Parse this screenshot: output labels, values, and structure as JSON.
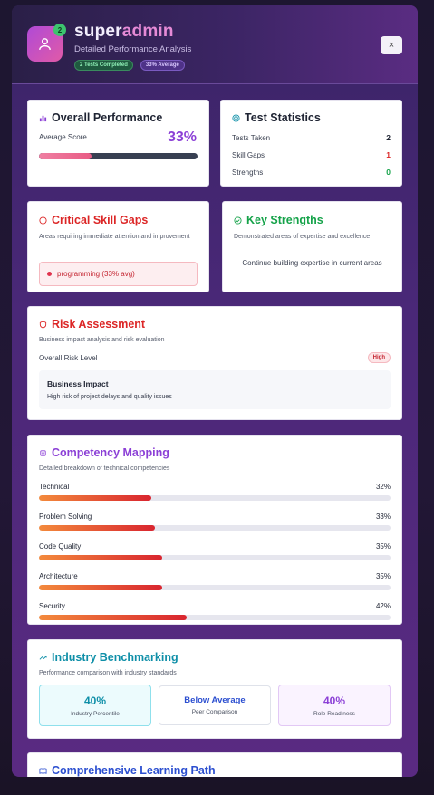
{
  "header": {
    "title_part1": "super",
    "title_part2": "admin",
    "subtitle": "Detailed Performance Analysis",
    "badge_count": "2",
    "chips": [
      "2 Tests Completed",
      "33% Average"
    ],
    "close_label": "×"
  },
  "overall": {
    "title": "Overall Performance",
    "avg_label": "Average Score",
    "avg_value": "33%",
    "avg_fraction": 0.33
  },
  "stats": {
    "title": "Test Statistics",
    "rows": [
      {
        "label": "Tests Taken",
        "value": "2",
        "color": "#1f2433"
      },
      {
        "label": "Skill Gaps",
        "value": "1",
        "color": "#dc2626"
      },
      {
        "label": "Strengths",
        "value": "0",
        "color": "#16a34a"
      }
    ]
  },
  "gaps": {
    "title": "Critical Skill Gaps",
    "subtitle": "Areas requiring immediate attention and improvement",
    "item": "programming (33% avg)"
  },
  "strengths": {
    "title": "Key Strengths",
    "subtitle": "Demonstrated areas of expertise and excellence",
    "empty_text": "Continue building expertise in current areas"
  },
  "risk": {
    "title": "Risk Assessment",
    "subtitle": "Business impact analysis and risk evaluation",
    "level_label": "Overall Risk Level",
    "level_value": "High",
    "impact_title": "Business Impact",
    "impact_text": "High risk of project delays and quality issues"
  },
  "competency": {
    "title": "Competency Mapping",
    "subtitle": "Detailed breakdown of technical competencies",
    "items": [
      {
        "label": "Technical",
        "value": "32%",
        "fraction": 0.32
      },
      {
        "label": "Problem Solving",
        "value": "33%",
        "fraction": 0.33
      },
      {
        "label": "Code Quality",
        "value": "35%",
        "fraction": 0.35
      },
      {
        "label": "Architecture",
        "value": "35%",
        "fraction": 0.35
      },
      {
        "label": "Security",
        "value": "42%",
        "fraction": 0.42
      }
    ]
  },
  "benchmark": {
    "title": "Industry Benchmarking",
    "subtitle": "Performance comparison with industry standards",
    "boxes": [
      {
        "value": "40%",
        "label": "Industry Percentile"
      },
      {
        "value": "Below Average",
        "label": "Peer Comparison"
      },
      {
        "value": "40%",
        "label": "Role Readiness"
      }
    ]
  },
  "learning": {
    "title": "Comprehensive Learning Path"
  },
  "colors": {
    "accent_purple": "#8b3fd6",
    "danger": "#dc2626",
    "success": "#16a34a",
    "teal": "#0e8fa8"
  }
}
